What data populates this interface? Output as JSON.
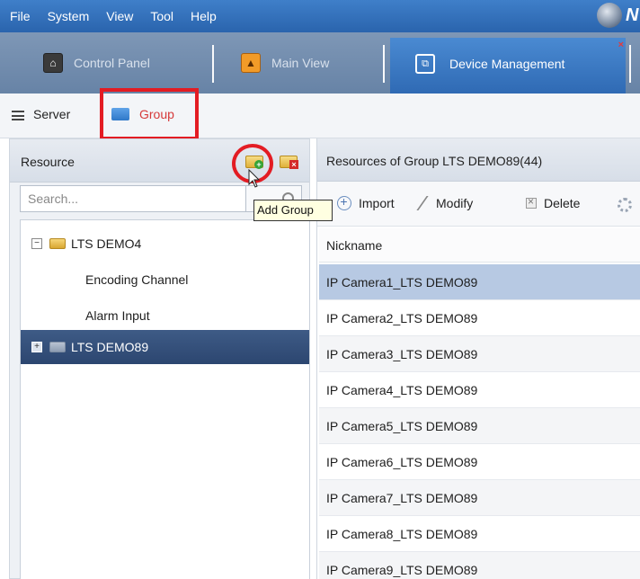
{
  "menu": [
    "File",
    "System",
    "View",
    "Tool",
    "Help"
  ],
  "logo_letter": "N",
  "tabs": {
    "control_panel": "Control Panel",
    "main_view": "Main View",
    "device_management": "Device Management",
    "close": "×"
  },
  "subbar": {
    "server": "Server",
    "group": "Group"
  },
  "resource_panel": {
    "title": "Resource",
    "search_placeholder": "Search...",
    "tooltip": "Add Group",
    "tree": [
      {
        "label": "LTS DEMO4",
        "expander": "−",
        "expanded": true
      },
      {
        "label": "Encoding Channel"
      },
      {
        "label": "Alarm Input"
      },
      {
        "label": "LTS DEMO89",
        "expander": "+",
        "selected": true
      }
    ]
  },
  "right_panel": {
    "title": "Resources of Group LTS DEMO89(44)",
    "toolbar": {
      "import": "Import",
      "modify": "Modify",
      "delete": "Delete"
    },
    "column": "Nickname",
    "rows": [
      "IP Camera1_LTS DEMO89",
      "IP Camera2_LTS DEMO89",
      "IP Camera3_LTS DEMO89",
      "IP Camera4_LTS DEMO89",
      "IP Camera5_LTS DEMO89",
      "IP Camera6_LTS DEMO89",
      "IP Camera7_LTS DEMO89",
      "IP Camera8_LTS DEMO89",
      "IP Camera9_LTS DEMO89"
    ]
  },
  "colors": {
    "highlight_red": "#e31c23",
    "selection_dark": "#2c4670",
    "row_selected": "#b7c9e3"
  }
}
